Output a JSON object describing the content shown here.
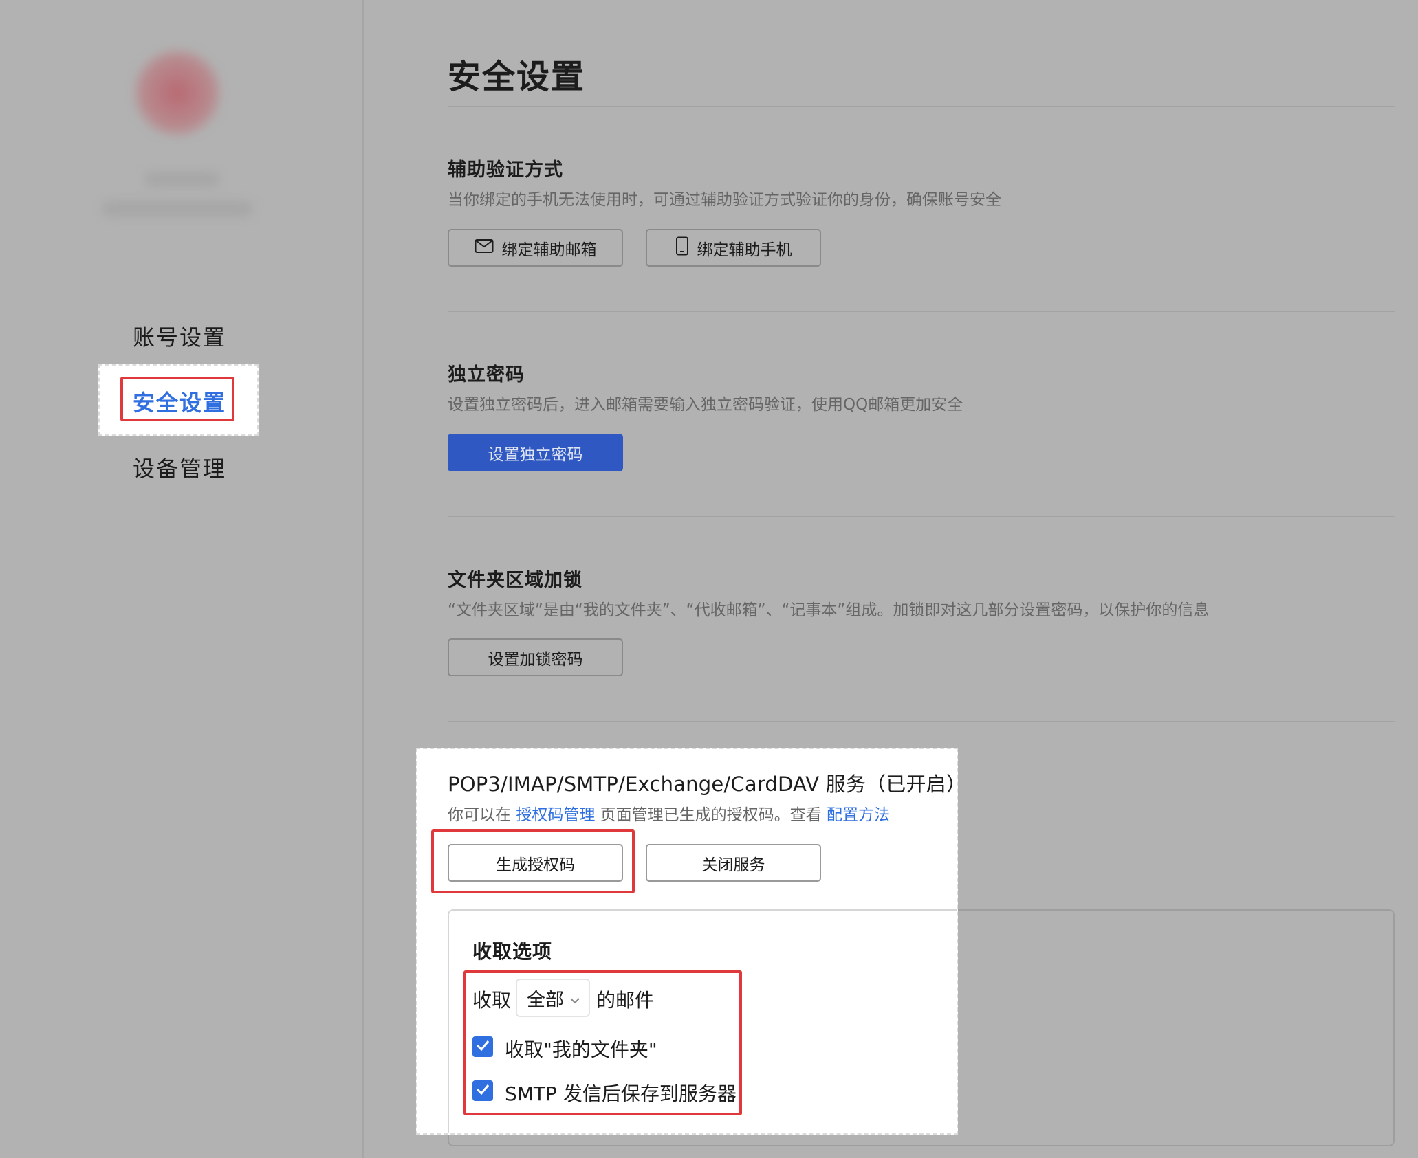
{
  "sidebar": {
    "items": [
      {
        "label": "账号设置"
      },
      {
        "label": "安全设置",
        "active": true
      },
      {
        "label": "设备管理"
      }
    ]
  },
  "page": {
    "title": "安全设置"
  },
  "sections": {
    "aux_verify": {
      "title": "辅助验证方式",
      "desc": "当你绑定的手机无法使用时，可通过辅助验证方式验证你的身份，确保账号安全",
      "bind_email_label": "绑定辅助邮箱",
      "bind_phone_label": "绑定辅助手机",
      "email_icon": "mail-icon",
      "phone_icon": "phone-icon"
    },
    "independent_password": {
      "title": "独立密码",
      "desc": "设置独立密码后，进入邮箱需要输入独立密码验证，使用QQ邮箱更加安全",
      "button_label": "设置独立密码"
    },
    "folder_lock": {
      "title": "文件夹区域加锁",
      "desc": "“文件夹区域”是由“我的文件夹”、“代收邮箱”、“记事本”组成。加锁即对这几部分设置密码，以保护你的信息",
      "button_label": "设置加锁密码"
    },
    "pop3": {
      "title": "POP3/IMAP/SMTP/Exchange/CardDAV 服务（已开启）",
      "desc_prefix": "你可以在 ",
      "desc_link1": "授权码管理",
      "desc_middle": " 页面管理已生成的授权码。查看 ",
      "desc_link2": "配置方法",
      "generate_label": "生成授权码",
      "close_label": "关闭服务",
      "receive_options": {
        "title": "收取选项",
        "receive_prefix": "收取",
        "select_value": "全部",
        "receive_suffix": "的邮件",
        "checkbox1_label": "收取\"我的文件夹\"",
        "checkbox1_checked": true,
        "checkbox2_label": "SMTP 发信后保存到服务器",
        "checkbox2_checked": true
      }
    }
  },
  "colors": {
    "accent": "#2f6fe0",
    "primary_button": "#2f58c2",
    "highlight_red": "#e0393b",
    "overlay_grey": "#b2b2b2"
  }
}
